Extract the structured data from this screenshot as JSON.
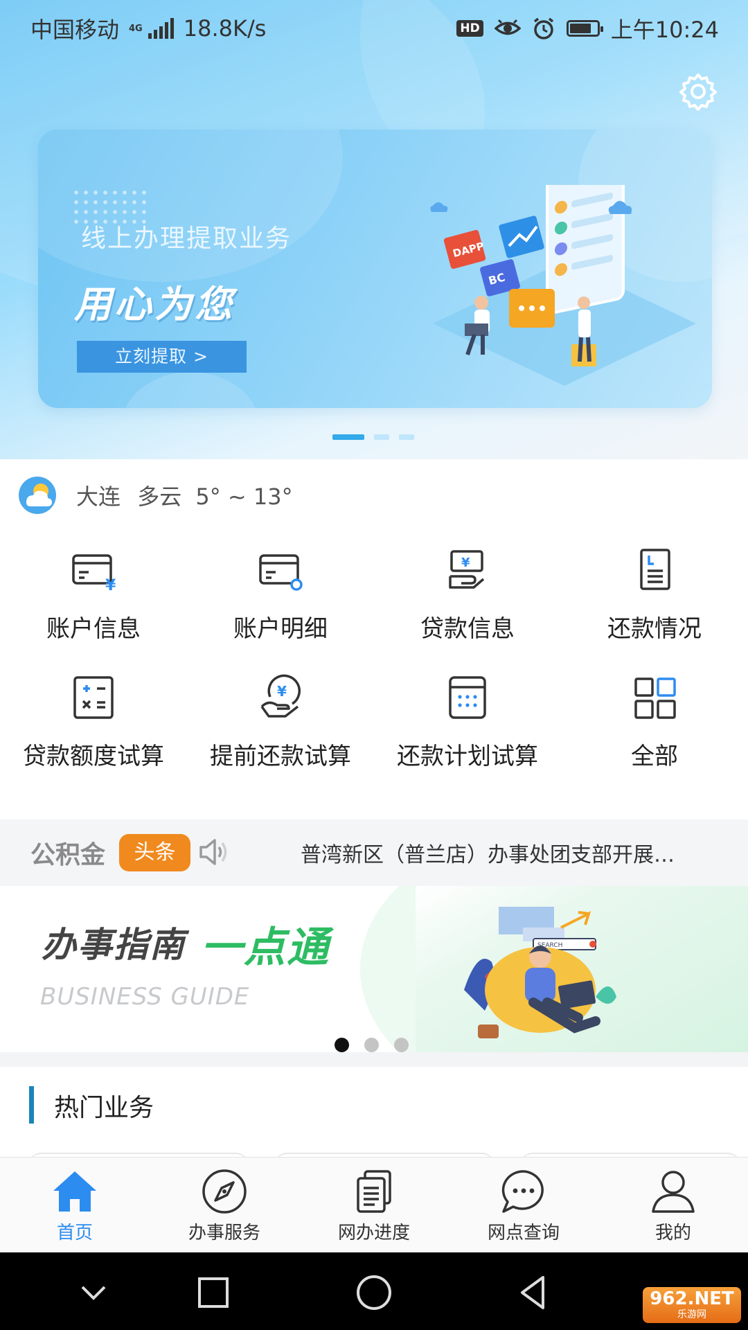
{
  "status_bar": {
    "carrier": "中国移动",
    "network_type": "4G",
    "net_speed": "18.8K/s",
    "hd": "HD",
    "time": "上午10:24"
  },
  "banner": {
    "subtitle": "线上办理提取业务",
    "title": "用心为您",
    "button": "立刻提取 >",
    "illus_tag1": "DAPP",
    "illus_tag2": "BC",
    "page_count": 3,
    "active_page": 1
  },
  "weather": {
    "city": "大连",
    "condition": "多云",
    "range": "5° ~ 13°"
  },
  "services": [
    {
      "label": "账户信息",
      "icon": "card-yuan-icon"
    },
    {
      "label": "账户明细",
      "icon": "card-detail-icon"
    },
    {
      "label": "贷款信息",
      "icon": "loan-hand-icon"
    },
    {
      "label": "还款情况",
      "icon": "document-icon"
    },
    {
      "label": "贷款额度试算",
      "icon": "calculator-icon"
    },
    {
      "label": "提前还款试算",
      "icon": "yuan-hand-icon"
    },
    {
      "label": "还款计划试算",
      "icon": "calendar-icon"
    },
    {
      "label": "全部",
      "icon": "grid-icon"
    }
  ],
  "news": {
    "brand": "公积金",
    "tag": "头条",
    "headline": "普湾新区（普兰店）办事处团支部开展…"
  },
  "guide": {
    "title": "办事指南",
    "highlight": "一点通",
    "subtitle": "BUSINESS GUIDE",
    "illus_search": "SEARCH",
    "page_count": 3,
    "active_page": 1
  },
  "hot": {
    "title": "热门业务"
  },
  "tabs": [
    {
      "label": "首页",
      "icon": "home-icon",
      "active": true
    },
    {
      "label": "办事服务",
      "icon": "compass-icon",
      "active": false
    },
    {
      "label": "网办进度",
      "icon": "documents-icon",
      "active": false
    },
    {
      "label": "网点查询",
      "icon": "chat-icon",
      "active": false
    },
    {
      "label": "我的",
      "icon": "user-icon",
      "active": false
    }
  ],
  "watermark": {
    "brand": "962.NET",
    "sub": "乐游网"
  },
  "colors": {
    "accent": "#2d8cf0",
    "tag_orange": "#f08a1e",
    "guide_green": "#2ebc63",
    "section_bar": "#1a86b8"
  }
}
